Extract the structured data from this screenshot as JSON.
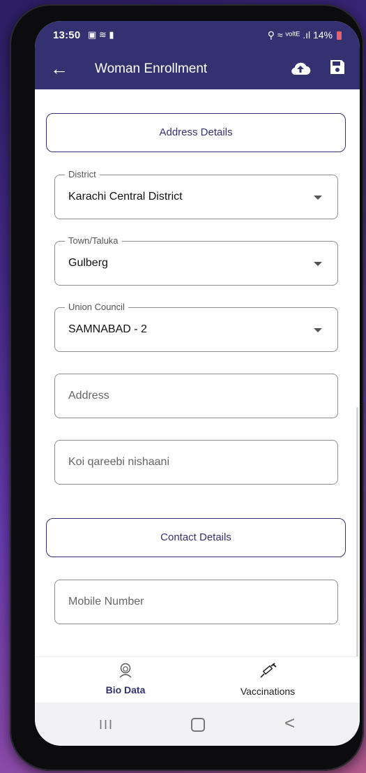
{
  "status_bar": {
    "time": "13:50",
    "left_icons": "▣ ≋ ▮",
    "right_text": "⚲ ≈ ᵛᵒˡᵗᴱ .ıl 14%"
  },
  "app_bar": {
    "back_icon": "←",
    "title": "Woman Enrollment",
    "upload_icon": "cloud-upload-icon",
    "save_icon": "save-icon",
    "color": "#33316f"
  },
  "sections": {
    "address": "Address Details",
    "contact": "Contact Details"
  },
  "fields": {
    "district": {
      "label": "District",
      "value": "Karachi Central District"
    },
    "town": {
      "label": "Town/Taluka",
      "value": "Gulberg"
    },
    "union_council": {
      "label": "Union Council",
      "value": "SAMNABAD - 2"
    },
    "address": {
      "placeholder": "Address"
    },
    "landmark": {
      "placeholder": "Koi qareebi nishaani"
    },
    "mobile": {
      "placeholder": "Mobile Number"
    }
  },
  "bottom_nav": {
    "bio_data": "Bio Data",
    "vaccinations": "Vaccinations"
  },
  "system_nav": {
    "recent": "III",
    "back": "<"
  }
}
